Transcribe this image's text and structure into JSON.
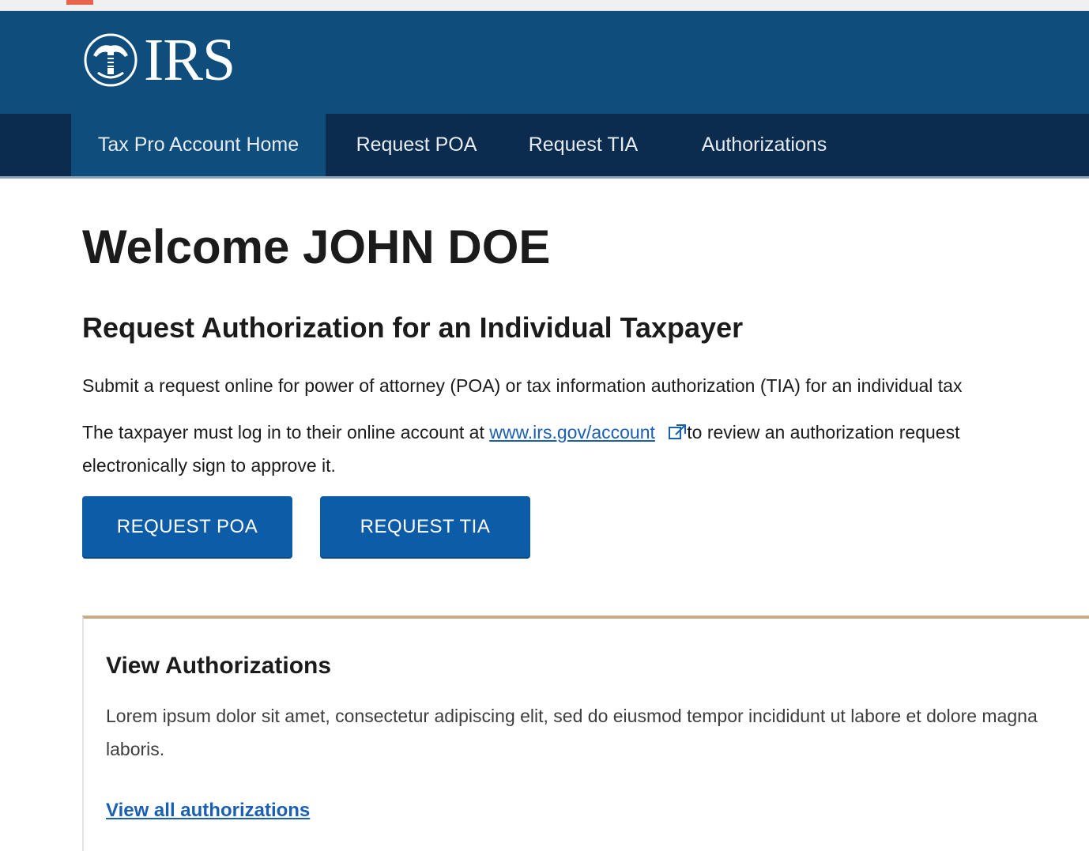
{
  "header": {
    "logo_text": "IRS",
    "logo_icon": "irs-eagle-emblem-icon",
    "colors": {
      "header_bg": "#0f4d7d",
      "nav_bg": "#0b2c4e",
      "button_bg": "#0d5ca8",
      "link": "#1a5fb4",
      "card_accent": "#c9ab85"
    }
  },
  "nav": {
    "items": [
      {
        "label": "Tax Pro Account Home",
        "active": true
      },
      {
        "label": "Request POA",
        "active": false
      },
      {
        "label": "Request TIA",
        "active": false
      },
      {
        "label": "Authorizations",
        "active": false
      }
    ]
  },
  "main": {
    "title": "Welcome JOHN DOE",
    "section_title": "Request Authorization for an Individual Taxpayer",
    "para1": "Submit a request online for power of attorney (POA) or tax information authorization (TIA) for an individual tax",
    "para2_before": "The taxpayer must log in to their online account at",
    "para2_link": "www.irs.gov/account",
    "para2_link_icon": "external-link-icon",
    "para2_after": "to review an authorization request",
    "para3": "electronically sign to approve it.",
    "buttons": {
      "request_poa": "REQUEST POA",
      "request_tia": "REQUEST TIA"
    }
  },
  "card": {
    "title": "View Authorizations",
    "text": "Lorem ipsum dolor sit amet, consectetur adipiscing elit, sed do eiusmod tempor incididunt ut labore et dolore magna laboris.",
    "link": "View all authorizations"
  }
}
